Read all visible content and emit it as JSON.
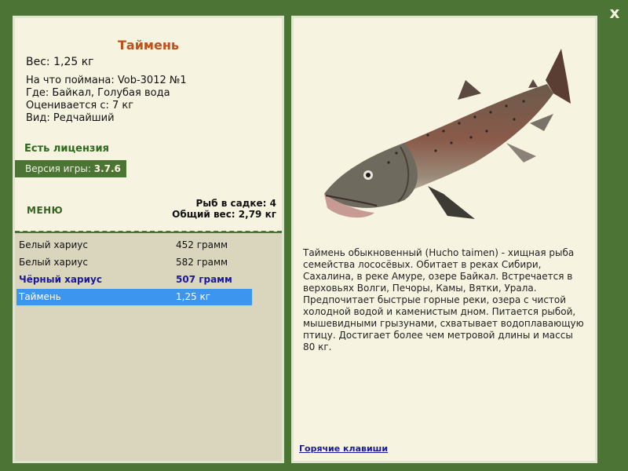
{
  "close_label": "x",
  "fish": {
    "title": "Таймень",
    "weight": "Вес: 1,25 кг",
    "caught_with": "На что поймана: Vob-3012 №1",
    "where": "Где: Байкал, Голубая вода",
    "rated_from": "Оценивается с: 7 кг",
    "kind": "Вид: Редчайший"
  },
  "license": "Есть лицензия",
  "version": {
    "label": "Версия игры:",
    "value": "3.7.6"
  },
  "menu_label": "МЕНЮ",
  "keepnet": {
    "count": "Рыб в садке: 4",
    "total_weight": "Общий вес: 2,79 кг"
  },
  "catches": [
    {
      "name": "Белый хариус",
      "weight": "452 грамм",
      "style": "normal"
    },
    {
      "name": "Белый хариус",
      "weight": "582 грамм",
      "style": "normal"
    },
    {
      "name": "Чёрный хариус",
      "weight": "507 грамм",
      "style": "bold"
    },
    {
      "name": "Таймень",
      "weight": "1,25 кг",
      "style": "selected"
    }
  ],
  "description": "Таймень обыкновенный (Hucho taimen) - хищная рыба семейства лососёвых. Обитает в реках Сибири, Сахалина, в реке Амуре, озере Байкал. Встречается в верховьях Волги, Печоры, Камы, Вятки, Урала. Предпочитает быстрые горные реки, озера с чистой холодной водой и каменистым дном. Питается рыбой, мышевидными грызунами, схватывает водоплавающую птицу. Достигает более чем метровой длины и массы 80 кг.",
  "hotkeys_label": "Горячие клавиши",
  "colors": {
    "frame_green": "#4c7434",
    "panel_cream": "#f7f3e1",
    "title_orange": "#c0501a",
    "selection_blue": "#3c96f0"
  }
}
